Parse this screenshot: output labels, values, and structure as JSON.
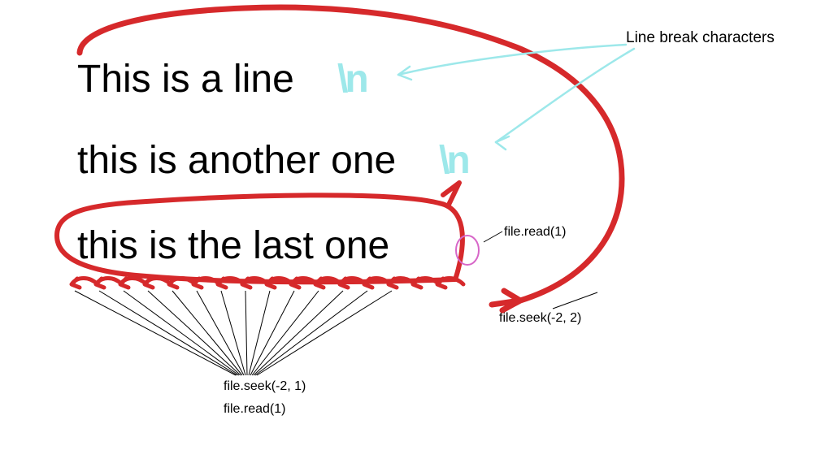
{
  "topLabel": "Line break characters",
  "line1": "This is a line",
  "nl1": "\\n",
  "line2": "this is another one",
  "nl2": "\\n",
  "line3": "this is the last one",
  "annot_read1": "file.read(1)",
  "annot_seek_neg2_2": "file.seek(-2, 2)",
  "annot_seek_neg2_1": "file.seek(-2, 1)",
  "annot_read1_b": "file.read(1)"
}
